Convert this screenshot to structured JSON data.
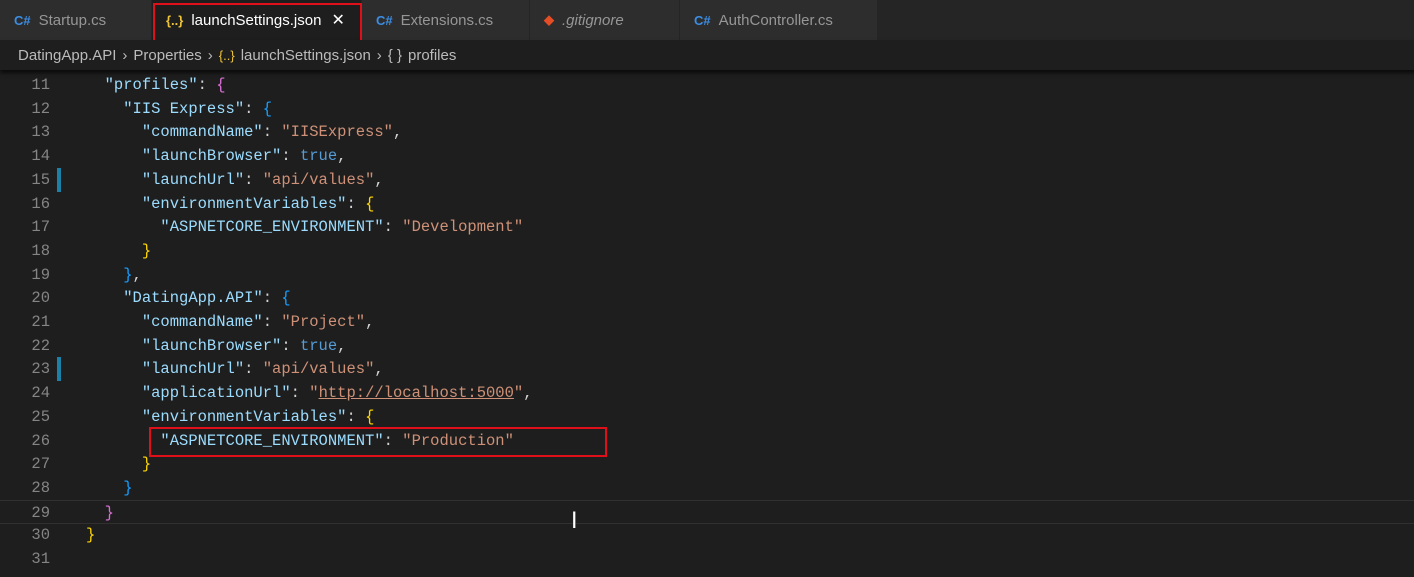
{
  "tabs": [
    {
      "label": "Startup.cs",
      "icon": "C#",
      "type": "cs"
    },
    {
      "label": "launchSettings.json",
      "icon": "{..}",
      "type": "js",
      "active": true,
      "close": "✕"
    },
    {
      "label": "Extensions.cs",
      "icon": "C#",
      "type": "cs"
    },
    {
      "label": ".gitignore",
      "icon": "◆",
      "type": "git"
    },
    {
      "label": "AuthController.cs",
      "icon": "C#",
      "type": "cs"
    }
  ],
  "breadcrumb": {
    "project": "DatingApp.API",
    "folder": "Properties",
    "file_icon": "{..}",
    "file": "launchSettings.json",
    "symbol_icon": "{ }",
    "symbol": "profiles",
    "sep": "›"
  },
  "colors": {
    "accent_red": "#e0101a",
    "key": "#9cdcfe",
    "string": "#ce9178",
    "keyword": "#569cd6"
  },
  "editor": {
    "current_line": 29,
    "modified_lines": [
      15,
      23
    ],
    "lines": [
      {
        "n": "11",
        "t": [
          [
            "p",
            "  "
          ],
          [
            "k",
            "\"profiles\""
          ],
          [
            "p",
            ": "
          ],
          [
            "m",
            "{"
          ]
        ]
      },
      {
        "n": "12",
        "t": [
          [
            "p",
            "    "
          ],
          [
            "k",
            "\"IIS Express\""
          ],
          [
            "p",
            ": "
          ],
          [
            "c",
            "{"
          ]
        ]
      },
      {
        "n": "13",
        "t": [
          [
            "p",
            "      "
          ],
          [
            "k",
            "\"commandName\""
          ],
          [
            "p",
            ": "
          ],
          [
            "s",
            "\"IISExpress\""
          ],
          [
            "p",
            ","
          ]
        ]
      },
      {
        "n": "14",
        "t": [
          [
            "p",
            "      "
          ],
          [
            "k",
            "\"launchBrowser\""
          ],
          [
            "p",
            ": "
          ],
          [
            "b",
            "true"
          ],
          [
            "p",
            ","
          ]
        ]
      },
      {
        "n": "15",
        "t": [
          [
            "p",
            "      "
          ],
          [
            "k",
            "\"launchUrl\""
          ],
          [
            "p",
            ": "
          ],
          [
            "s",
            "\"api/values\""
          ],
          [
            "p",
            ","
          ]
        ]
      },
      {
        "n": "16",
        "t": [
          [
            "p",
            "      "
          ],
          [
            "k",
            "\"environmentVariables\""
          ],
          [
            "p",
            ": "
          ],
          [
            "y",
            "{"
          ]
        ]
      },
      {
        "n": "17",
        "t": [
          [
            "p",
            "        "
          ],
          [
            "k",
            "\"ASPNETCORE_ENVIRONMENT\""
          ],
          [
            "p",
            ": "
          ],
          [
            "s",
            "\"Development\""
          ]
        ]
      },
      {
        "n": "18",
        "t": [
          [
            "p",
            "      "
          ],
          [
            "y",
            "}"
          ]
        ]
      },
      {
        "n": "19",
        "t": [
          [
            "p",
            "    "
          ],
          [
            "c",
            "}"
          ],
          [
            "p",
            ","
          ]
        ]
      },
      {
        "n": "20",
        "t": [
          [
            "p",
            "    "
          ],
          [
            "k",
            "\"DatingApp.API\""
          ],
          [
            "p",
            ": "
          ],
          [
            "c",
            "{"
          ]
        ]
      },
      {
        "n": "21",
        "t": [
          [
            "p",
            "      "
          ],
          [
            "k",
            "\"commandName\""
          ],
          [
            "p",
            ": "
          ],
          [
            "s",
            "\"Project\""
          ],
          [
            "p",
            ","
          ]
        ]
      },
      {
        "n": "22",
        "t": [
          [
            "p",
            "      "
          ],
          [
            "k",
            "\"launchBrowser\""
          ],
          [
            "p",
            ": "
          ],
          [
            "b",
            "true"
          ],
          [
            "p",
            ","
          ]
        ]
      },
      {
        "n": "23",
        "t": [
          [
            "p",
            "      "
          ],
          [
            "k",
            "\"launchUrl\""
          ],
          [
            "p",
            ": "
          ],
          [
            "s",
            "\"api/values\""
          ],
          [
            "p",
            ","
          ]
        ]
      },
      {
        "n": "24",
        "t": [
          [
            "p",
            "      "
          ],
          [
            "k",
            "\"applicationUrl\""
          ],
          [
            "p",
            ": "
          ],
          [
            "s",
            "\""
          ],
          [
            "s u",
            "http://localhost:5000"
          ],
          [
            "s",
            "\""
          ],
          [
            "p",
            ","
          ]
        ]
      },
      {
        "n": "25",
        "t": [
          [
            "p",
            "      "
          ],
          [
            "k",
            "\"environmentVariables\""
          ],
          [
            "p",
            ": "
          ],
          [
            "y",
            "{"
          ]
        ]
      },
      {
        "n": "26",
        "t": [
          [
            "p",
            "        "
          ],
          [
            "k",
            "\"ASPNETCORE_ENVIRONMENT\""
          ],
          [
            "p",
            ": "
          ],
          [
            "s",
            "\"Production\""
          ]
        ]
      },
      {
        "n": "27",
        "t": [
          [
            "p",
            "      "
          ],
          [
            "y",
            "}"
          ]
        ]
      },
      {
        "n": "28",
        "t": [
          [
            "p",
            "    "
          ],
          [
            "c",
            "}"
          ]
        ]
      },
      {
        "n": "29",
        "t": [
          [
            "p",
            "  "
          ],
          [
            "m",
            "}"
          ]
        ]
      },
      {
        "n": "30",
        "t": [
          [
            "y",
            "}"
          ]
        ]
      },
      {
        "n": "31",
        "t": []
      }
    ]
  }
}
